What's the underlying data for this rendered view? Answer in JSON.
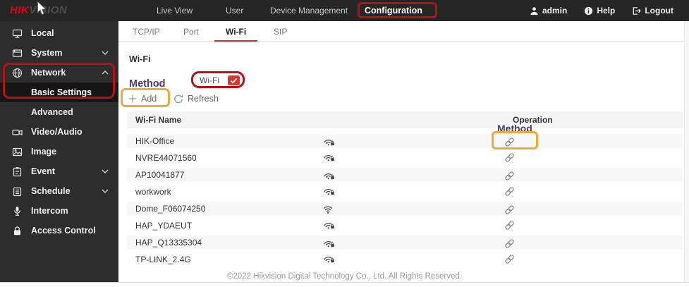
{
  "topbar": {
    "logo": {
      "part1": "HIK",
      "part2": "VISION"
    },
    "nav": [
      {
        "label": "Live View"
      },
      {
        "label": "User"
      },
      {
        "label": "Device Management"
      },
      {
        "label": "Configuration",
        "active": true,
        "annotation": "red-box"
      }
    ],
    "user_menu": {
      "username": "admin",
      "help_label": "Help",
      "logout_label": "Logout"
    }
  },
  "sidebar": {
    "items": [
      {
        "label": "Local",
        "icon": "monitor-icon"
      },
      {
        "label": "System",
        "icon": "system-icon",
        "chevron": "down"
      },
      {
        "label": "Network",
        "icon": "globe-icon",
        "chevron": "up",
        "expanded": true,
        "annotation": "red-box"
      },
      {
        "label": "Basic Settings",
        "parent": "Network",
        "active": true,
        "annotation": "red-box"
      },
      {
        "label": "Advanced",
        "parent": "Network"
      },
      {
        "label": "Video/Audio",
        "icon": "video-camera-icon"
      },
      {
        "label": "Image",
        "icon": "image-icon"
      },
      {
        "label": "Event",
        "icon": "event-icon",
        "chevron": "down"
      },
      {
        "label": "Schedule",
        "icon": "schedule-icon",
        "chevron": "down"
      },
      {
        "label": "Intercom",
        "icon": "microphone-icon"
      },
      {
        "label": "Access Control",
        "icon": "lock-icon"
      }
    ]
  },
  "main": {
    "tabs": [
      {
        "label": "TCP/IP"
      },
      {
        "label": "Port"
      },
      {
        "label": "Wi-Fi",
        "active": true
      },
      {
        "label": "SIP"
      }
    ],
    "section_title": "Wi-Fi",
    "method_label": "Method",
    "wifi_enable": {
      "label": "Wi-Fi",
      "checked": true,
      "annotation": "red-box"
    },
    "toolbar": {
      "add_label": "Add",
      "refresh_label": "Refresh",
      "add_annotation": "yellow-box"
    },
    "table": {
      "headers": {
        "name": "Wi-Fi Name",
        "operation": "Operation",
        "operation_overlap": "Method"
      },
      "rows": [
        {
          "name": "HIK-Office",
          "signal": "wifi-secured",
          "operation_icon": "link-icon",
          "annotation": "yellow-box"
        },
        {
          "name": "NVRE44071560",
          "signal": "wifi-secured",
          "operation_icon": "link-icon"
        },
        {
          "name": "AP10041877",
          "signal": "wifi-secured",
          "operation_icon": "link-icon"
        },
        {
          "name": "workwork",
          "signal": "wifi-secured",
          "operation_icon": "link-icon"
        },
        {
          "name": "Dome_F06074250",
          "signal": "wifi-open",
          "operation_icon": "link-icon"
        },
        {
          "name": "HAP_YDAEUT",
          "signal": "wifi-secured",
          "operation_icon": "link-icon"
        },
        {
          "name": "HAP_Q13335304",
          "signal": "wifi-secured",
          "operation_icon": "link-icon"
        },
        {
          "name": "TP-LINK_2.4G",
          "signal": "wifi-secured",
          "operation_icon": "link-icon"
        }
      ]
    }
  },
  "footer": {
    "copyright": "©2022 Hikvision Digital Technology Co., Ltd. All Rights Reserved."
  },
  "colors": {
    "brand_red": "#e60012",
    "topbar_bg": "#262626",
    "sidebar_bg": "#2d2d2d",
    "tab_active_red": "#d42d26",
    "checkbox_red": "#d5382f",
    "method_purple": "#4b3c77",
    "annotation_red": "#b31217",
    "annotation_yellow": "#edaa3d",
    "table_header_bg": "#f4f4f4",
    "row_alt_bg": "#f7f7f8"
  }
}
